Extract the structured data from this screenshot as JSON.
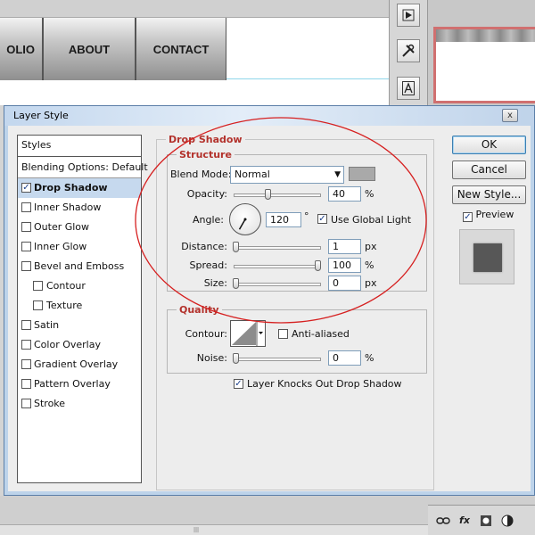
{
  "background": {
    "menu": [
      "OLIO",
      "ABOUT",
      "CONTACT"
    ]
  },
  "tools": {
    "icons": [
      "play-icon",
      "tools-icon",
      "character-icon"
    ]
  },
  "layers_panel": {
    "bottom_icons": [
      "link-icon",
      "fx-icon",
      "mask-icon",
      "adjustment-icon"
    ],
    "fx_label": "fx"
  },
  "dialog": {
    "title": "Layer Style",
    "close_label": "x",
    "styles_list": {
      "header": "Styles",
      "blending": "Blending Options: Default",
      "items": [
        {
          "label": "Drop Shadow",
          "checked": true,
          "active": true
        },
        {
          "label": "Inner Shadow",
          "checked": false
        },
        {
          "label": "Outer Glow",
          "checked": false
        },
        {
          "label": "Inner Glow",
          "checked": false
        },
        {
          "label": "Bevel and Emboss",
          "checked": false
        },
        {
          "label": "Contour",
          "checked": false,
          "sub": true
        },
        {
          "label": "Texture",
          "checked": false,
          "sub": true
        },
        {
          "label": "Satin",
          "checked": false
        },
        {
          "label": "Color Overlay",
          "checked": false
        },
        {
          "label": "Gradient Overlay",
          "checked": false
        },
        {
          "label": "Pattern Overlay",
          "checked": false
        },
        {
          "label": "Stroke",
          "checked": false
        }
      ]
    },
    "drop_shadow": {
      "title": "Drop Shadow",
      "structure": {
        "title": "Structure",
        "blend_mode_label": "Blend Mode:",
        "blend_mode_value": "Normal",
        "shadow_color": "#a9a9a9",
        "opacity_label": "Opacity:",
        "opacity_value": "40",
        "opacity_unit": "%",
        "opacity_level": 0.4,
        "angle_label": "Angle:",
        "angle_value": "120",
        "angle_unit": "°",
        "angle_degrees": 120,
        "global_light_label": "Use Global Light",
        "global_light_checked": true,
        "distance_label": "Distance:",
        "distance_value": "1",
        "distance_unit": "px",
        "spread_label": "Spread:",
        "spread_value": "100",
        "spread_unit": "%",
        "spread_level": 1.0,
        "size_label": "Size:",
        "size_value": "0",
        "size_unit": "px"
      },
      "quality": {
        "title": "Quality",
        "contour_label": "Contour:",
        "anti_aliased_label": "Anti-aliased",
        "anti_aliased_checked": false,
        "noise_label": "Noise:",
        "noise_value": "0",
        "noise_unit": "%"
      },
      "knockout_label": "Layer Knocks Out Drop Shadow",
      "knockout_checked": true
    },
    "buttons": {
      "ok": "OK",
      "cancel": "Cancel",
      "new_style": "New Style...",
      "preview_label": "Preview",
      "preview_checked": true
    }
  },
  "colors": {
    "legend_red": "#b3322c",
    "annotation_red": "#d62020",
    "selection_blue": "#c6d9ee"
  }
}
